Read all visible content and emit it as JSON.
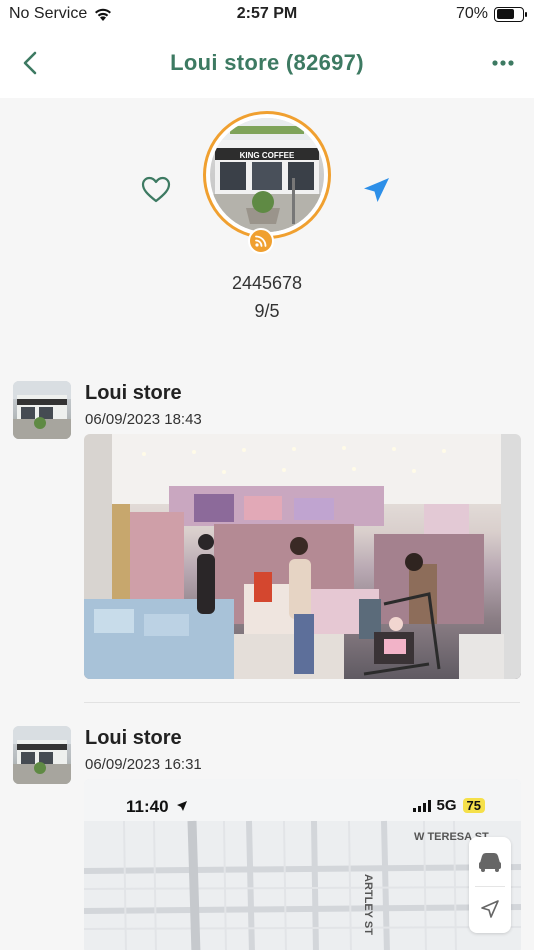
{
  "status_bar": {
    "carrier": "No Service",
    "time": "2:57 PM",
    "battery_percent": "70%",
    "battery_level": 0.7
  },
  "header": {
    "title": "Loui store (82697)"
  },
  "profile": {
    "sign_text": "KING COFFEE",
    "code": "2445678",
    "date": "9/5",
    "ring_color": "#f0a030",
    "accent_color": "#3d7a62",
    "nav_arrow_color": "#2d8fe8"
  },
  "feed": [
    {
      "name": "Loui store",
      "timestamp": "06/09/2023 18:43",
      "photo_kind": "store-interior"
    },
    {
      "name": "Loui store",
      "timestamp": "06/09/2023 16:31",
      "photo_kind": "map-screenshot",
      "map": {
        "time": "11:40",
        "network": "5G",
        "battery": "75",
        "streets": [
          "W TERESA ST",
          "ARTLEY ST"
        ]
      }
    }
  ]
}
